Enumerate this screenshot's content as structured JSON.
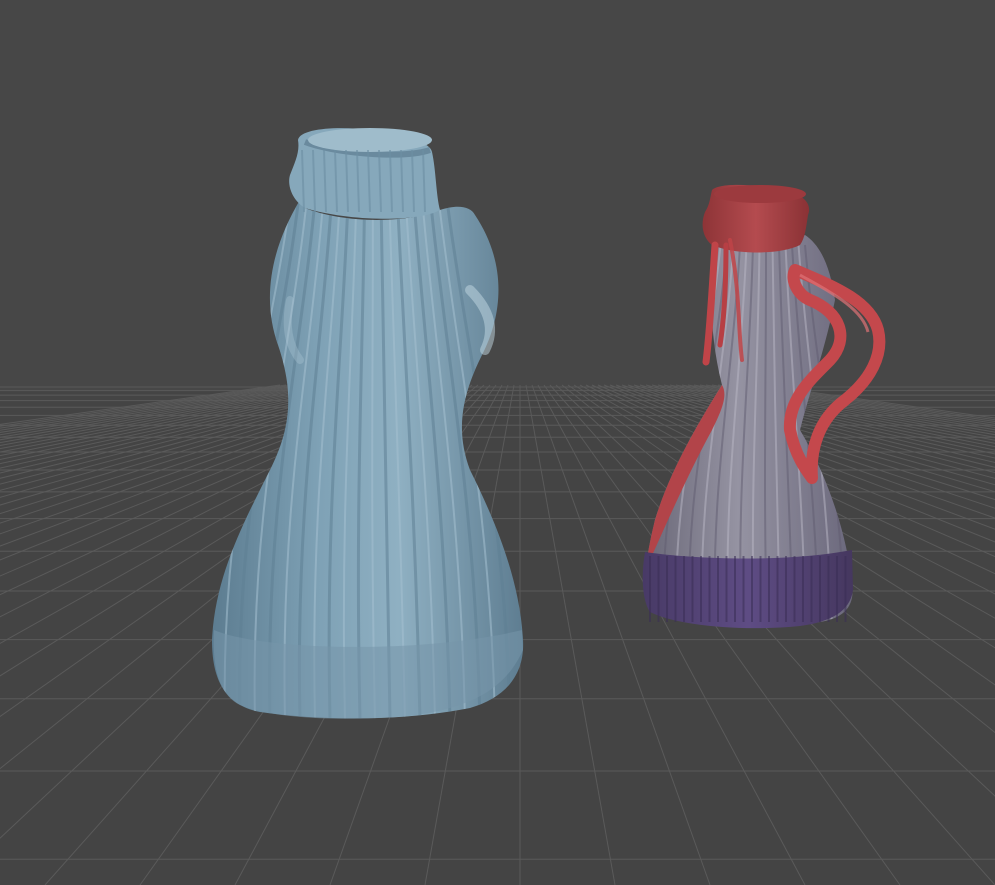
{
  "viewport": {
    "background": "#474747",
    "grid_color": "#5d5d5d"
  },
  "scene": {
    "objects": [
      {
        "name": "sweater-dress-blue",
        "colors": {
          "body": "#7a9cb0",
          "body_dark": "#5c7c90",
          "collar": "#86a8bb",
          "highlight": "#b7d0dd"
        }
      },
      {
        "name": "sweater-dress-color-id",
        "colors": {
          "body": "#8a8898",
          "body_dark": "#6d6a7e",
          "collar": "#b04a4e",
          "sleeve": "#c04448",
          "hem": "#5b4a7e"
        }
      }
    ]
  }
}
